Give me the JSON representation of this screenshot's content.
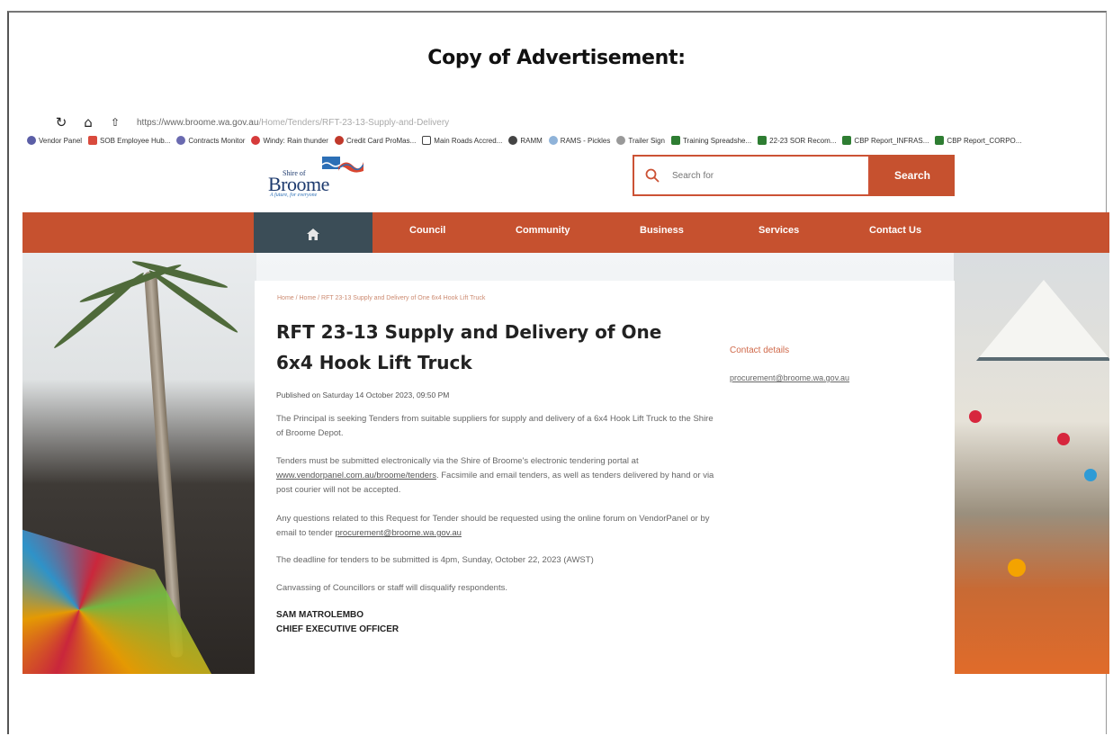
{
  "document": {
    "heading": "Copy of Advertisement:"
  },
  "browser": {
    "url_host": "https://www.broome.wa.gov.au",
    "url_path": "/Home/Tenders/RFT-23-13-Supply-and-Delivery",
    "bookmarks": [
      {
        "label": "Vendor Panel",
        "color": "#5b5ea6",
        "shape": "circle"
      },
      {
        "label": "SOB Employee Hub...",
        "color": "#d94a3d",
        "shape": "square"
      },
      {
        "label": "Contracts Monitor",
        "color": "#6a6ab0",
        "shape": "circle"
      },
      {
        "label": "Windy: Rain thunder",
        "color": "#d63b3b",
        "shape": "circle"
      },
      {
        "label": "Credit Card ProMas...",
        "color": "#c0392b",
        "shape": "circle"
      },
      {
        "label": "Main Roads Accred...",
        "color": "#ffffff",
        "shape": "square"
      },
      {
        "label": "RAMM",
        "color": "#444444",
        "shape": "circle"
      },
      {
        "label": "RAMS - Pickles",
        "color": "#8fb3d9",
        "shape": "circle"
      },
      {
        "label": "Trailer Sign",
        "color": "#999999",
        "shape": "circle"
      },
      {
        "label": "Training Spreadshe...",
        "color": "#2e7d32",
        "shape": "square"
      },
      {
        "label": "22-23 SOR Recom...",
        "color": "#2e7d32",
        "shape": "square"
      },
      {
        "label": "CBP Report_INFRAS...",
        "color": "#2e7d32",
        "shape": "square"
      },
      {
        "label": "CBP Report_CORPO...",
        "color": "#2e7d32",
        "shape": "square"
      }
    ]
  },
  "site": {
    "logo": {
      "shire_of": "Shire of",
      "name": "Broome",
      "tagline": "A future, for everyone"
    },
    "search": {
      "placeholder": "Search for",
      "button": "Search"
    },
    "nav": {
      "home_icon": "home-icon",
      "items": [
        "Council",
        "Community",
        "Business",
        "Services",
        "Contact Us"
      ]
    },
    "colors": {
      "brand_orange": "#c6512f",
      "nav_home": "#3b4d57",
      "logo_blue": "#1d3a6e"
    }
  },
  "article": {
    "breadcrumb": "Home  /  Home  /  RFT 23-13 Supply and Delivery of One 6x4 Hook Lift Truck",
    "title": "RFT 23-13 Supply and Delivery of One 6x4 Hook Lift Truck",
    "published": "Published on Saturday 14 October 2023, 09:50 PM",
    "para1": "The Principal is seeking Tenders from suitable suppliers for supply and delivery of a 6x4 Hook Lift Truck to the Shire of Broome Depot.",
    "para2_pre": "Tenders must be submitted electronically via the Shire of Broome's electronic tendering portal at ",
    "para2_link": "www.vendorpanel.com.au/broome/tenders",
    "para2_post": ". Facsimile and email tenders, as well as tenders delivered by hand or via post courier will not be accepted.",
    "para3_pre": "Any questions related to this Request for Tender should be requested using the online forum on VendorPanel or by email to tender ",
    "para3_link": "procurement@broome.wa.gov.au",
    "para4": "The deadline for tenders to be submitted is 4pm, Sunday, October 22, 2023 (AWST)",
    "para5": "Canvassing of Councillors or staff will disqualify respondents.",
    "signatory_name": "SAM MATROLEMBO",
    "signatory_title": "CHIEF EXECUTIVE OFFICER"
  },
  "sidebar": {
    "contact_heading": "Contact details",
    "contact_email": "procurement@broome.wa.gov.au"
  }
}
